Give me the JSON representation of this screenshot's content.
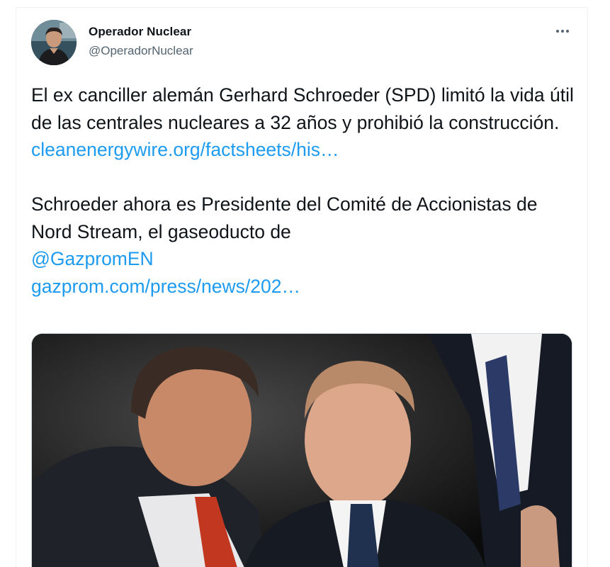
{
  "tweet": {
    "author_name": "Operador Nuclear",
    "author_handle": "@OperadorNuclear",
    "more_icon": "ellipsis-icon",
    "paragraph1_text": "El ex canciller alemán Gerhard Schroeder (SPD) limitó la vida útil de las centrales nucleares a 32 años y prohibió la construcción.",
    "link1": "cleanenergywire.org/factsheets/his…",
    "paragraph2_text": "Schroeder ahora es Presidente del Comité de Accionistas de Nord Stream, el gaseoducto de",
    "mention": "@GazpromEN",
    "link2": "gazprom.com/press/news/202…"
  },
  "colors": {
    "link": "#1d9bf0",
    "secondary_text": "#536471",
    "border": "#eff3f4"
  }
}
